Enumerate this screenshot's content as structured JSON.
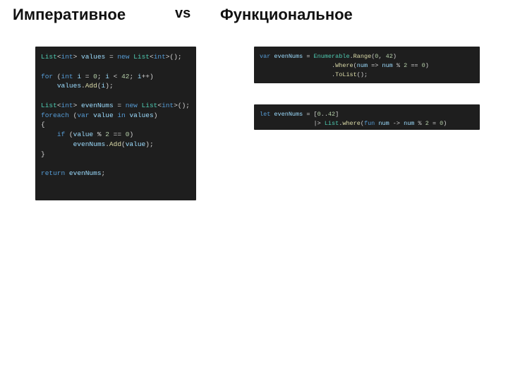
{
  "header": {
    "left": "Императивное",
    "vs": "vs",
    "right": "Функциональное"
  },
  "left_code": {
    "tokens": [
      [
        [
          "type",
          "List"
        ],
        [
          "pun",
          "<"
        ],
        [
          "kw",
          "int"
        ],
        [
          "pun",
          ">"
        ],
        [
          "op",
          " "
        ],
        [
          "ident",
          "values"
        ],
        [
          "op",
          " = "
        ],
        [
          "kw",
          "new"
        ],
        [
          "op",
          " "
        ],
        [
          "type",
          "List"
        ],
        [
          "pun",
          "<"
        ],
        [
          "kw",
          "int"
        ],
        [
          "pun",
          ">();"
        ]
      ],
      [
        [
          "op",
          ""
        ]
      ],
      [
        [
          "kw",
          "for"
        ],
        [
          "op",
          " ("
        ],
        [
          "kw",
          "int"
        ],
        [
          "op",
          " "
        ],
        [
          "ident",
          "i"
        ],
        [
          "op",
          " = "
        ],
        [
          "num",
          "0"
        ],
        [
          "op",
          "; "
        ],
        [
          "ident",
          "i"
        ],
        [
          "op",
          " < "
        ],
        [
          "num",
          "42"
        ],
        [
          "op",
          "; "
        ],
        [
          "ident",
          "i"
        ],
        [
          "op",
          "++)"
        ]
      ],
      [
        [
          "op",
          "    "
        ],
        [
          "ident",
          "values"
        ],
        [
          "pun",
          "."
        ],
        [
          "fn",
          "Add"
        ],
        [
          "pun",
          "("
        ],
        [
          "ident",
          "i"
        ],
        [
          "pun",
          ");"
        ]
      ],
      [
        [
          "op",
          ""
        ]
      ],
      [
        [
          "type",
          "List"
        ],
        [
          "pun",
          "<"
        ],
        [
          "kw",
          "int"
        ],
        [
          "pun",
          ">"
        ],
        [
          "op",
          " "
        ],
        [
          "ident",
          "evenNums"
        ],
        [
          "op",
          " = "
        ],
        [
          "kw",
          "new"
        ],
        [
          "op",
          " "
        ],
        [
          "type",
          "List"
        ],
        [
          "pun",
          "<"
        ],
        [
          "kw",
          "int"
        ],
        [
          "pun",
          ">();"
        ]
      ],
      [
        [
          "kw",
          "foreach"
        ],
        [
          "op",
          " ("
        ],
        [
          "kw",
          "var"
        ],
        [
          "op",
          " "
        ],
        [
          "ident",
          "value"
        ],
        [
          "op",
          " "
        ],
        [
          "kw",
          "in"
        ],
        [
          "op",
          " "
        ],
        [
          "ident",
          "values"
        ],
        [
          "op",
          ")"
        ]
      ],
      [
        [
          "pun",
          "{"
        ]
      ],
      [
        [
          "op",
          "    "
        ],
        [
          "kw",
          "if"
        ],
        [
          "op",
          " ("
        ],
        [
          "ident",
          "value"
        ],
        [
          "op",
          " % "
        ],
        [
          "num",
          "2"
        ],
        [
          "op",
          " == "
        ],
        [
          "num",
          "0"
        ],
        [
          "op",
          ")"
        ]
      ],
      [
        [
          "op",
          "        "
        ],
        [
          "ident",
          "evenNums"
        ],
        [
          "pun",
          "."
        ],
        [
          "fn",
          "Add"
        ],
        [
          "pun",
          "("
        ],
        [
          "ident",
          "value"
        ],
        [
          "pun",
          ");"
        ]
      ],
      [
        [
          "pun",
          "}"
        ]
      ],
      [
        [
          "op",
          ""
        ]
      ],
      [
        [
          "kw",
          "return"
        ],
        [
          "op",
          " "
        ],
        [
          "ident",
          "evenNums"
        ],
        [
          "pun",
          ";"
        ]
      ]
    ]
  },
  "right_code_1": {
    "tokens": [
      [
        [
          "kw",
          "var"
        ],
        [
          "op",
          " "
        ],
        [
          "ident",
          "evenNums"
        ],
        [
          "op",
          " = "
        ],
        [
          "type",
          "Enumerable"
        ],
        [
          "pun",
          "."
        ],
        [
          "fn",
          "Range"
        ],
        [
          "pun",
          "("
        ],
        [
          "num",
          "0"
        ],
        [
          "pun",
          ", "
        ],
        [
          "num",
          "42"
        ],
        [
          "pun",
          ")"
        ]
      ],
      [
        [
          "op",
          "                    "
        ],
        [
          "pun",
          "."
        ],
        [
          "fn",
          "Where"
        ],
        [
          "pun",
          "("
        ],
        [
          "ident",
          "num"
        ],
        [
          "op",
          " => "
        ],
        [
          "ident",
          "num"
        ],
        [
          "op",
          " % "
        ],
        [
          "num",
          "2"
        ],
        [
          "op",
          " == "
        ],
        [
          "num",
          "0"
        ],
        [
          "pun",
          ")"
        ]
      ],
      [
        [
          "op",
          "                    "
        ],
        [
          "pun",
          "."
        ],
        [
          "fn",
          "ToList"
        ],
        [
          "pun",
          "();"
        ]
      ]
    ]
  },
  "right_code_2": {
    "tokens": [
      [
        [
          "kw",
          "let"
        ],
        [
          "op",
          " "
        ],
        [
          "ident",
          "evenNums"
        ],
        [
          "op",
          " = ["
        ],
        [
          "num",
          "0"
        ],
        [
          "op",
          ".."
        ],
        [
          "num",
          "42"
        ],
        [
          "op",
          "]"
        ]
      ],
      [
        [
          "op",
          "               |> "
        ],
        [
          "type",
          "List"
        ],
        [
          "pun",
          "."
        ],
        [
          "fn",
          "where"
        ],
        [
          "pun",
          "("
        ],
        [
          "kw",
          "fun"
        ],
        [
          "op",
          " "
        ],
        [
          "ident",
          "num"
        ],
        [
          "op",
          " -> "
        ],
        [
          "ident",
          "num"
        ],
        [
          "op",
          " % "
        ],
        [
          "num",
          "2"
        ],
        [
          "op",
          " = "
        ],
        [
          "num",
          "0"
        ],
        [
          "pun",
          ")"
        ]
      ]
    ]
  }
}
